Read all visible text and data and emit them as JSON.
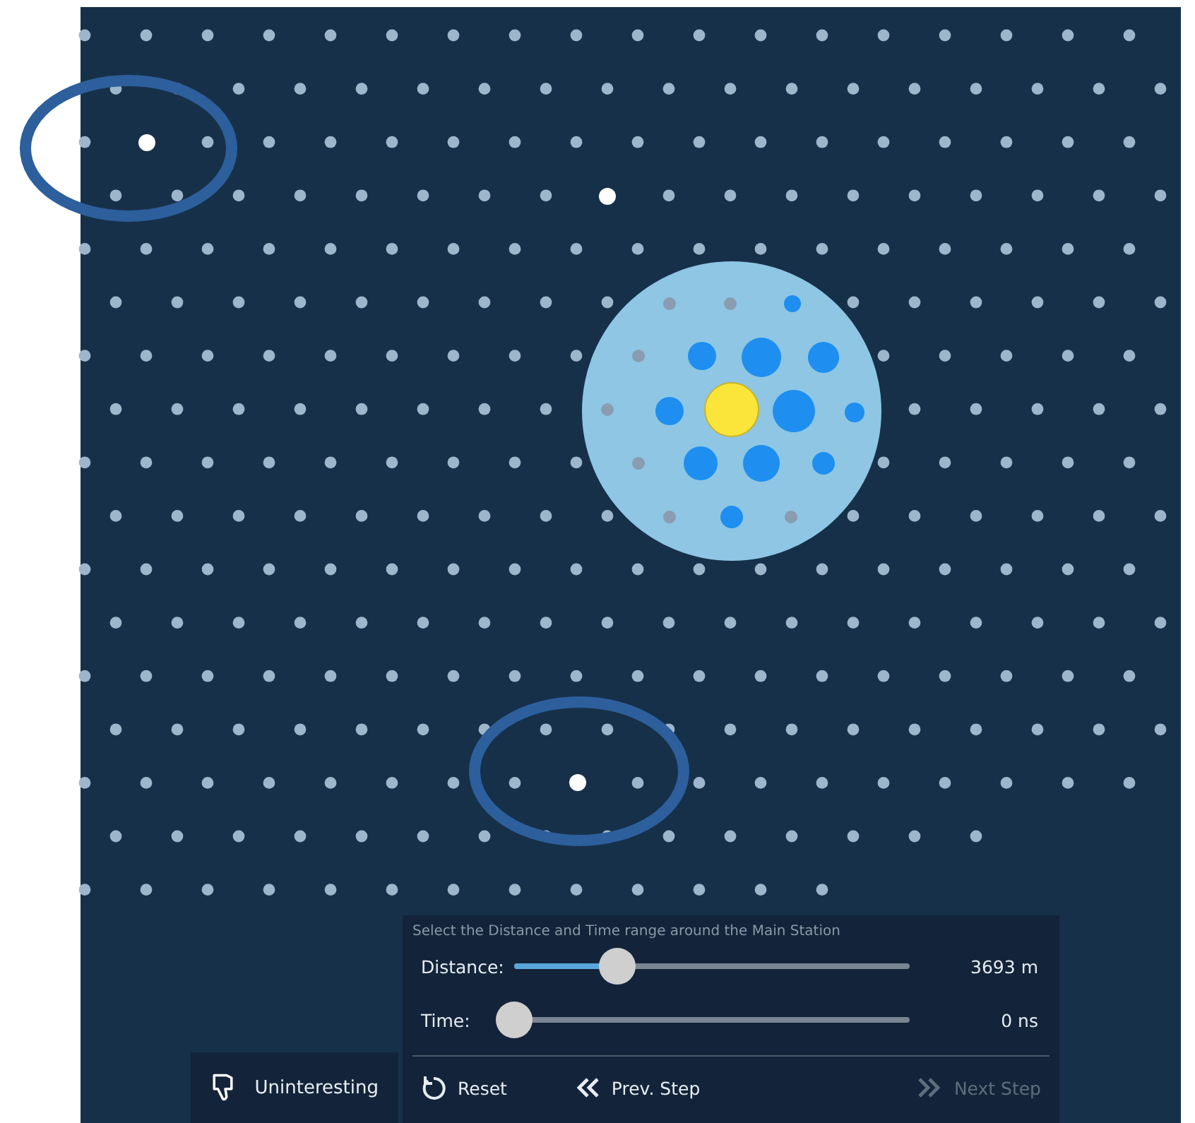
{
  "panel": {
    "instruction": "Select the Distance and Time range around the Main Station",
    "sliders": [
      {
        "label": "Distance:",
        "level": 0.26,
        "reading": "3693 m"
      },
      {
        "label": "Time:",
        "level": 0,
        "reading": "0 ns"
      }
    ],
    "buttons": [
      {
        "kind": "reset",
        "label": "Reset",
        "disabled": false
      },
      {
        "kind": "prev",
        "label": "Prev. Step",
        "disabled": false
      },
      {
        "kind": "next",
        "label": "Next Step",
        "disabled": true
      }
    ]
  },
  "feedback_button": {
    "label": "Uninteresting"
  }
}
